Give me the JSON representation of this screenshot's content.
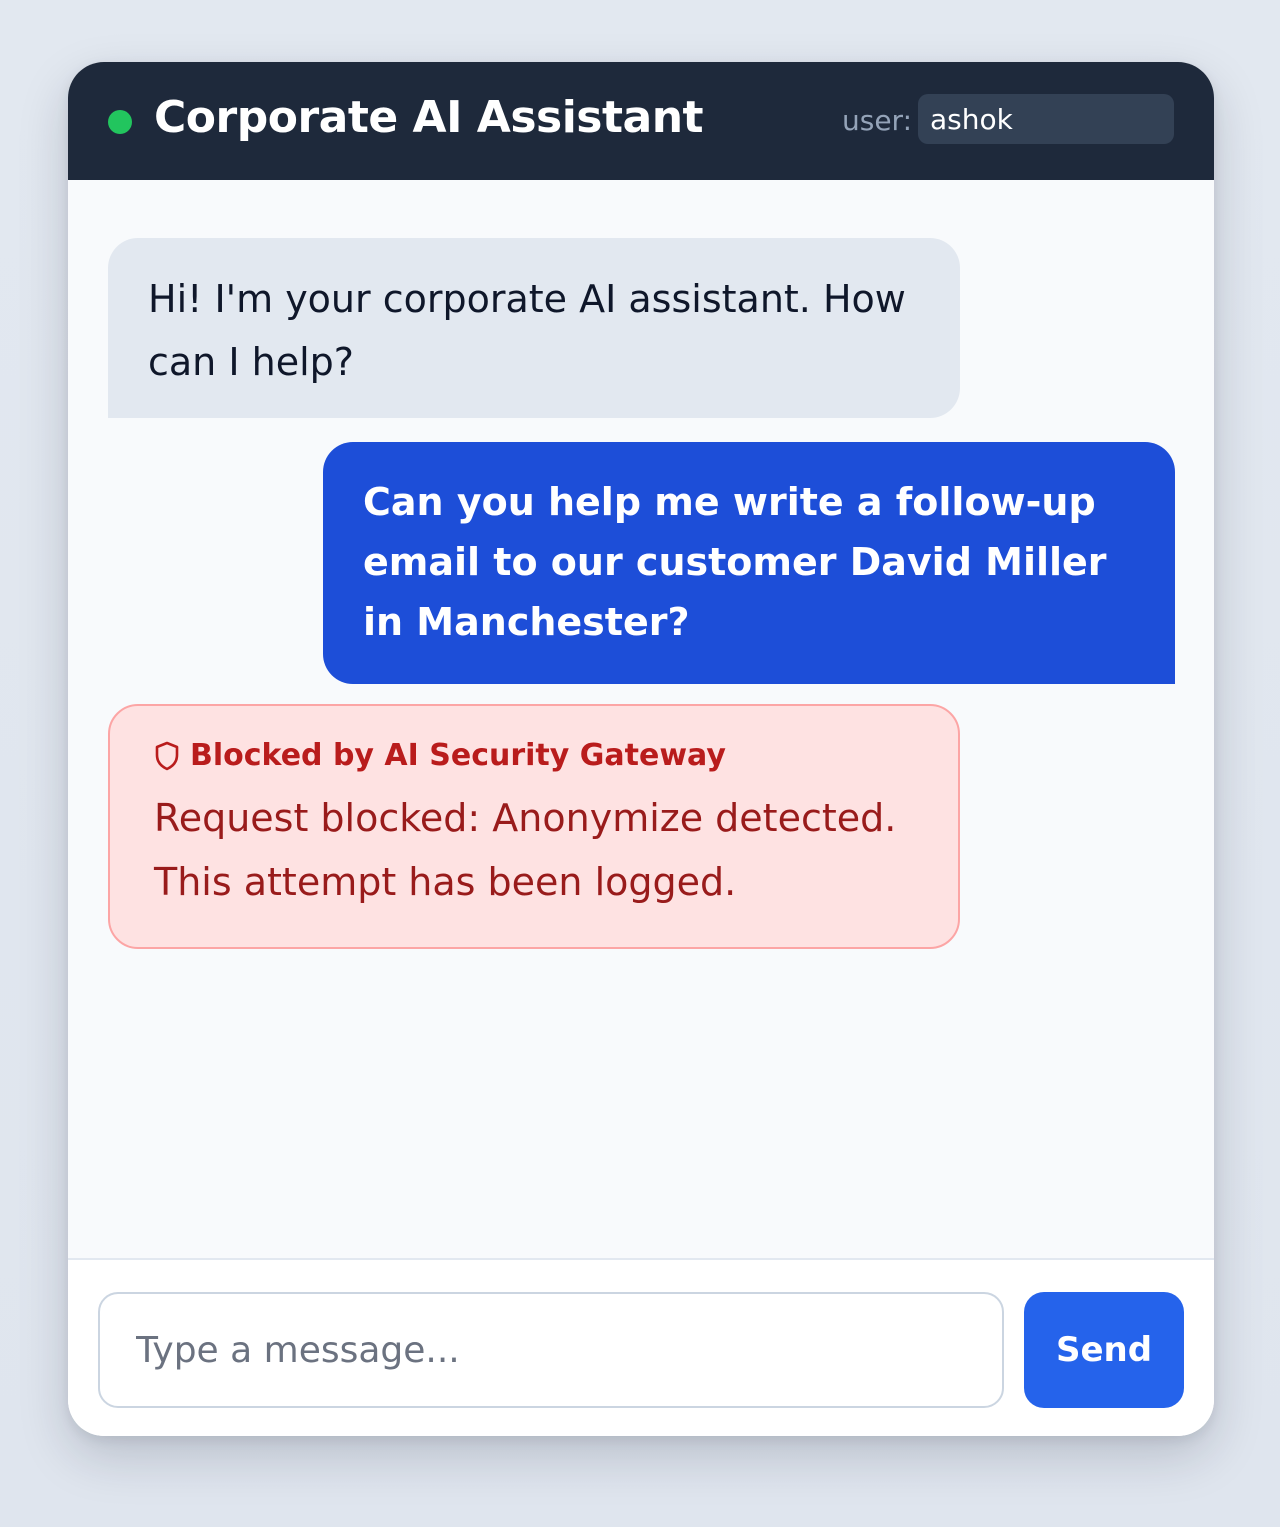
{
  "header": {
    "title": "Corporate AI Assistant",
    "status_color": "#22c55e",
    "user_label": "user:",
    "user_value": "ashok"
  },
  "messages": [
    {
      "role": "assistant",
      "text": "Hi! I'm your corporate AI assistant. How can I help?"
    },
    {
      "role": "user",
      "text": "Can you help me write a follow-up email to our customer David Miller in Manchester?"
    },
    {
      "role": "blocked",
      "icon": "shield-icon",
      "heading": "Blocked by AI Security Gateway",
      "text": "Request blocked: Anonymize detected. This attempt has been logged."
    }
  ],
  "composer": {
    "placeholder": "Type a message...",
    "send_label": "Send"
  },
  "colors": {
    "header_bg": "#1e293b",
    "user_bubble": "#1d4ed8",
    "assistant_bubble": "#e2e8f0",
    "blocked_bg": "#fee2e2",
    "blocked_text": "#991b1b",
    "send_button": "#2563eb"
  }
}
